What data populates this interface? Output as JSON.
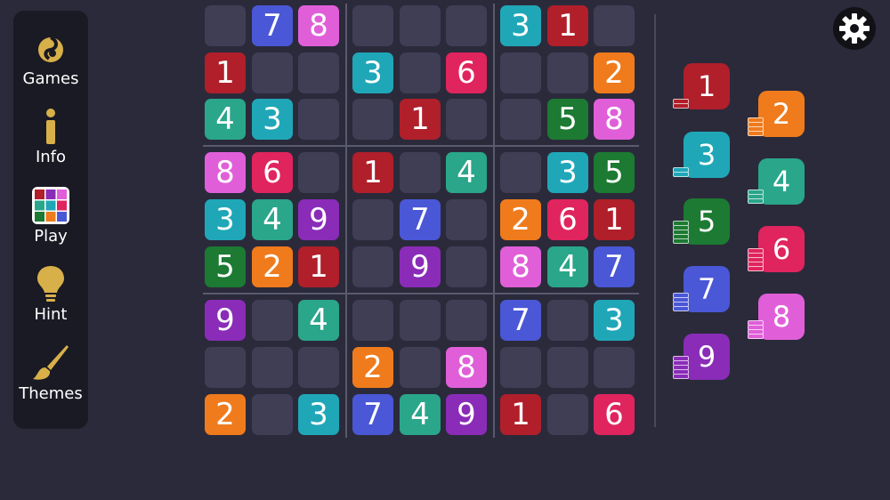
{
  "sidebar": {
    "items": [
      {
        "label": "Games",
        "icon": "games-icon"
      },
      {
        "label": "Info",
        "icon": "info-icon"
      },
      {
        "label": "Play",
        "icon": "play-grid-icon"
      },
      {
        "label": "Hint",
        "icon": "lightbulb-icon"
      },
      {
        "label": "Themes",
        "icon": "paintbrush-icon"
      }
    ]
  },
  "colors": {
    "1": "#b01f2a",
    "2": "#ef7b1c",
    "3": "#1fa7b8",
    "4": "#2aa68a",
    "5": "#1c7a32",
    "6": "#e0245e",
    "7": "#4a57d6",
    "8": "#e05fd9",
    "9": "#8a2cb8",
    "empty": "#3f3e55",
    "accent": "#d8b04a"
  },
  "board": {
    "grid": [
      [
        "",
        "7",
        "8",
        "",
        "",
        "",
        "3",
        "1",
        ""
      ],
      [
        "1",
        "",
        "",
        "3",
        "",
        "6",
        "",
        "",
        "2"
      ],
      [
        "4",
        "3",
        "",
        "",
        "1",
        "",
        "",
        "5",
        "8"
      ],
      [
        "8",
        "6",
        "",
        "1",
        "",
        "4",
        "",
        "3",
        "5"
      ],
      [
        "3",
        "4",
        "9",
        "",
        "7",
        "",
        "2",
        "6",
        "1"
      ],
      [
        "5",
        "2",
        "1",
        "",
        "9",
        "",
        "8",
        "4",
        "7"
      ],
      [
        "9",
        "",
        "4",
        "",
        "",
        "",
        "7",
        "",
        "3"
      ],
      [
        "",
        "",
        "",
        "2",
        "",
        "8",
        "",
        "",
        ""
      ],
      [
        "2",
        "",
        "3",
        "7",
        "4",
        "9",
        "1",
        "",
        "6"
      ]
    ]
  },
  "picker": {
    "numbers": [
      "1",
      "2",
      "3",
      "4",
      "5",
      "6",
      "7",
      "8",
      "9"
    ],
    "stack_counts": [
      2,
      4,
      2,
      3,
      5,
      5,
      4,
      4,
      5
    ]
  },
  "settings": {
    "icon": "gear-icon"
  }
}
